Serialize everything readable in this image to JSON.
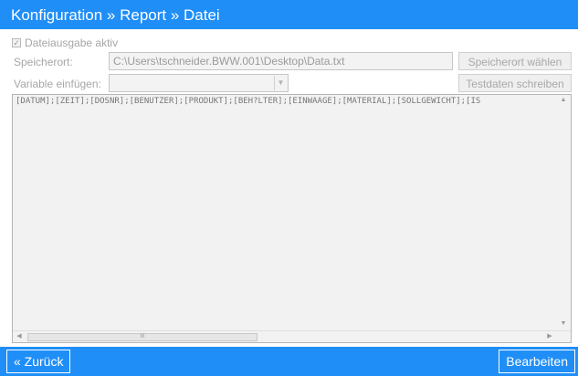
{
  "header": {
    "title": "Konfiguration » Report » Datei"
  },
  "form": {
    "enable_label": "Dateiausgabe aktiv",
    "enable_checked": true,
    "location_label": "Speicherort:",
    "location_value": "C:\\Users\\tschneider.BWW.001\\Desktop\\Data.txt",
    "choose_location_button": "Speicherort wählen",
    "insert_variable_label": "Variable einfügen:",
    "insert_variable_value": "",
    "write_test_data_button": "Testdaten schreiben"
  },
  "template": {
    "text": "[DATUM];[ZEIT];[DOSNR];[BENUTZER];[PRODUKT];[BEH?LTER];[EINWAAGE];[MATERIAL];[SOLLGEWICHT];[IS"
  },
  "footer": {
    "back_button": "« Zurück",
    "edit_button": "Bearbeiten"
  },
  "colors": {
    "accent": "#1f8ef7"
  }
}
